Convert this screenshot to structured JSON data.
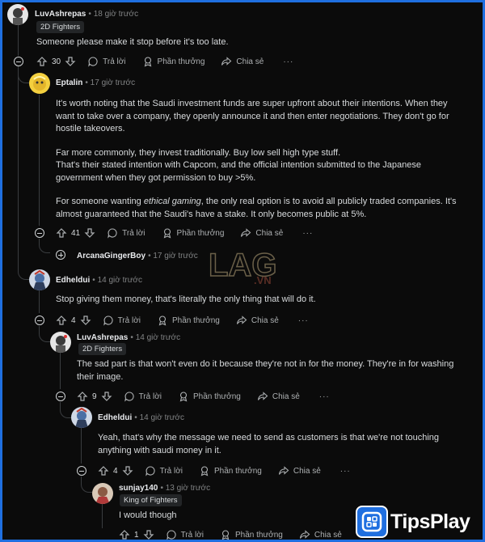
{
  "comments": [
    {
      "user": "LuvAshrepas",
      "time": "• 18 giờ trước",
      "flair": "2D Fighters",
      "text": "Someone please make it stop before it's too late.",
      "votes": "30"
    },
    {
      "user": "Eptalin",
      "time": "• 17 giờ trước",
      "p1": "It's worth noting that the Saudi investment funds are super upfront about their intentions. When they want to take over a company, they openly announce it and then enter negotiations. They don't go for hostile takeovers.",
      "p2a": "Far more commonly, they invest traditionally. Buy low sell high type stuff.",
      "p2b": "That's their stated intention with Capcom, and the official intention submitted to the Japanese government when they got permission to buy >5%.",
      "p3_pre": "For someone wanting ",
      "p3_em": "ethical gaming",
      "p3_post": ", the only real option is to avoid all publicly traded companies. It's almost guaranteed that the Saudi's have a stake. It only becomes public at 5%.",
      "votes": "41"
    },
    {
      "user": "ArcanaGingerBoy",
      "time": "• 17 giờ trước"
    },
    {
      "user": "Edheldui",
      "time": "• 14 giờ trước",
      "text": "Stop giving them money, that's literally the only thing that will do it.",
      "votes": "4"
    },
    {
      "user": "LuvAshrepas",
      "time": "• 14 giờ trước",
      "flair": "2D Fighters",
      "text": "The sad part is that won't even do it because they're not in for the money. They're in for washing their image.",
      "votes": "9"
    },
    {
      "user": "Edheldui",
      "time": "• 14 giờ trước",
      "text": "Yeah, that's why the message we need to send as customers is that we're not touching anything with saudi money in it.",
      "votes": "4"
    },
    {
      "user": "sunjay140",
      "time": "• 13 giờ trước",
      "flair": "King of Fighters",
      "text": "I would though",
      "votes": "1"
    }
  ],
  "actions": {
    "reply": "Trả lời",
    "award": "Phần thưởng",
    "share": "Chia sẻ",
    "more": "···"
  },
  "watermark": {
    "lag": "LAG",
    "vn": ".VN"
  },
  "brand": {
    "tips": "Tips",
    "play": "Play"
  },
  "icons": [
    "minus-circle-icon",
    "plus-circle-icon",
    "upvote-icon",
    "downvote-icon",
    "comment-icon",
    "award-icon",
    "share-icon",
    "more-icon"
  ],
  "colors": {
    "background": "#0b0b0b",
    "frame": "#1f6fe0",
    "text": "#d7dadc",
    "muted": "#818384"
  }
}
